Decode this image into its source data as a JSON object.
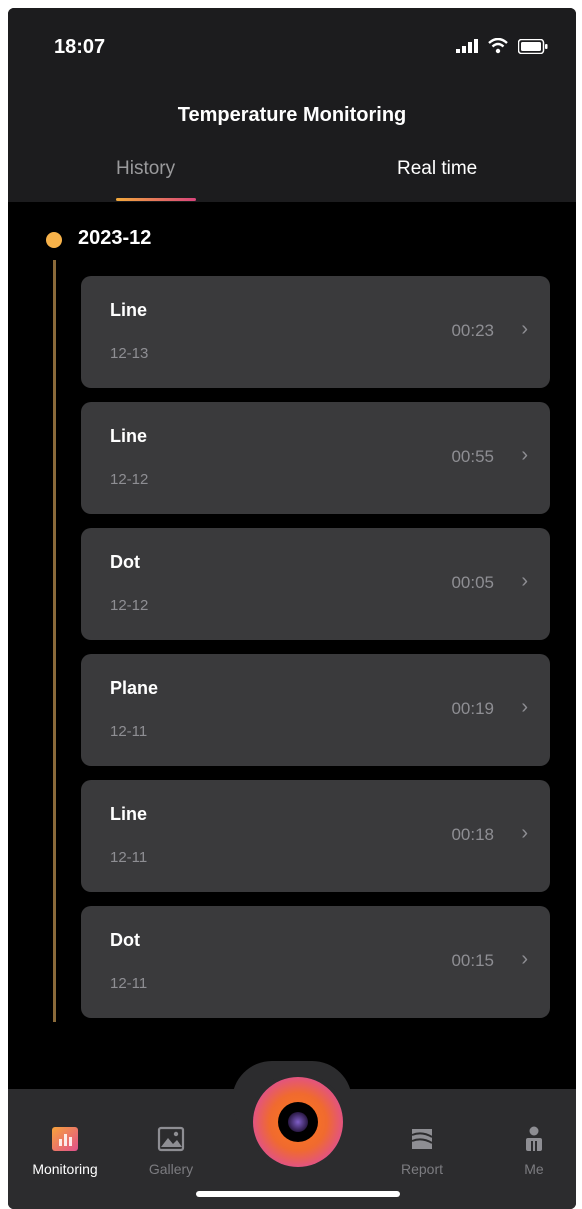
{
  "status_bar": {
    "time": "18:07"
  },
  "header": {
    "title": "Temperature Monitoring"
  },
  "tabs": [
    {
      "label": "History",
      "active": true
    },
    {
      "label": "Real time",
      "active": false
    }
  ],
  "timeline": {
    "month": "2023-12",
    "records": [
      {
        "title": "Line",
        "date": "12-13",
        "duration": "00:23",
        "chevron": "›"
      },
      {
        "title": "Line",
        "date": "12-12",
        "duration": "00:55",
        "chevron": "›"
      },
      {
        "title": "Dot",
        "date": "12-12",
        "duration": "00:05",
        "chevron": "›"
      },
      {
        "title": "Plane",
        "date": "12-11",
        "duration": "00:19",
        "chevron": "›"
      },
      {
        "title": "Line",
        "date": "12-11",
        "duration": "00:18",
        "chevron": "›"
      },
      {
        "title": "Dot",
        "date": "12-11",
        "duration": "00:15",
        "chevron": "›"
      }
    ]
  },
  "bottom_nav": {
    "items": [
      {
        "label": "Monitoring",
        "icon": "bar-chart-icon",
        "active": true
      },
      {
        "label": "Gallery",
        "icon": "image-icon",
        "active": false
      },
      {
        "label": "Report",
        "icon": "report-icon",
        "active": false
      },
      {
        "label": "Me",
        "icon": "person-icon",
        "active": false
      }
    ],
    "camera": {
      "icon": "camera-lens-icon"
    }
  },
  "colors": {
    "accent_orange": "#f7b24a",
    "accent_pink": "#d9457c",
    "card_bg": "#3a3a3c",
    "bar_bg": "#1c1c1e"
  }
}
